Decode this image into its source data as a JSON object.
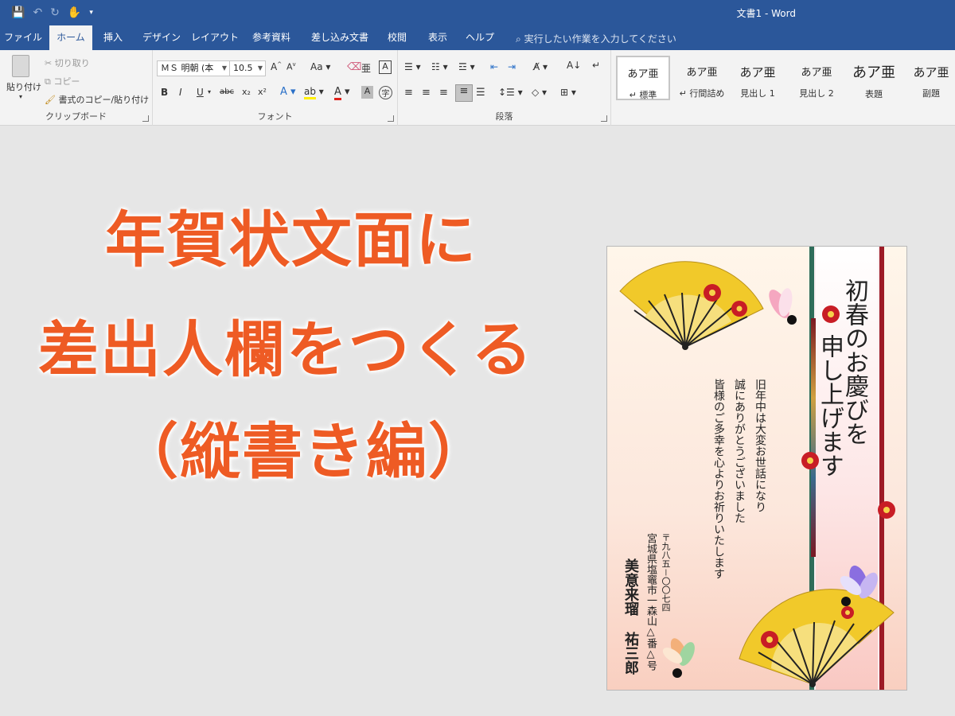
{
  "window": {
    "title": "文書1 - Word"
  },
  "tabs": [
    "ファイル",
    "ホーム",
    "挿入",
    "デザイン",
    "レイアウト",
    "参考資料",
    "差し込み文書",
    "校閲",
    "表示",
    "ヘルプ"
  ],
  "tell_me": "実行したい作業を入力してください",
  "clipboard": {
    "paste": "貼り付け",
    "cut": "切り取り",
    "copy": "コピー",
    "format_painter": "書式のコピー/貼り付け",
    "label": "クリップボード"
  },
  "font": {
    "name": "ＭＳ 明朝 (本",
    "size": "10.5",
    "label": "フォント",
    "buttons": [
      "B",
      "I",
      "U",
      "abc",
      "x₂",
      "x²"
    ]
  },
  "paragraph": {
    "label": "段落"
  },
  "styles": [
    {
      "sample": "あア亜",
      "name": "↵ 標準"
    },
    {
      "sample": "あア亜",
      "name": "↵ 行間詰め"
    },
    {
      "sample": "あア亜",
      "name": "見出し 1"
    },
    {
      "sample": "あア亜",
      "name": "見出し 2"
    },
    {
      "sample": "あア亜",
      "name": "表題"
    },
    {
      "sample": "あア亜",
      "name": "副題"
    }
  ],
  "headline": {
    "line1": "年賀状文面に",
    "line2": "差出人欄をつくる",
    "line3": "（縦書き編）"
  },
  "card": {
    "greeting_1": "初春のお慶びを",
    "greeting_2": "申し上げます",
    "body_1": "旧年中は大変お世話になり",
    "body_2": "誠にありがとうございました",
    "body_3": "皆様のご多幸を心よりお祈りいたします",
    "postal": "〒九八五－〇〇七四",
    "address": "宮城県塩竈市一森山△番△号",
    "name_1": "美意来瑠",
    "name_2": "祐三郎"
  },
  "colors": {
    "accent": "#2b579a",
    "headline": "#ee5b24",
    "ribbon": "#f3f3f3"
  }
}
